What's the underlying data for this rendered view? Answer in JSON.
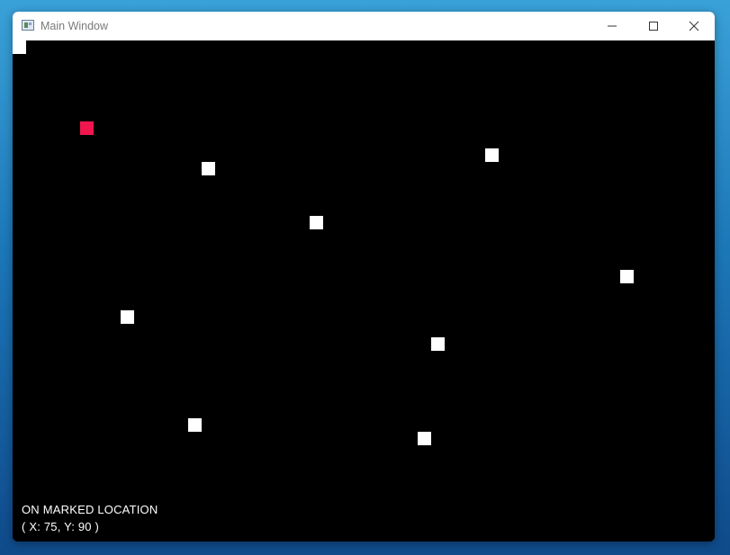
{
  "window": {
    "title": "Main Window",
    "minimize_icon": "minimize-icon",
    "maximize_icon": "maximize-icon",
    "close_icon": "close-icon"
  },
  "game": {
    "background_color": "#000000",
    "tile_color": "#ffffff",
    "marked_tile_color": "#f0174f",
    "status_line_1": "ON MARKED LOCATION",
    "status_line_2": "( X: 75, Y: 90 )"
  }
}
